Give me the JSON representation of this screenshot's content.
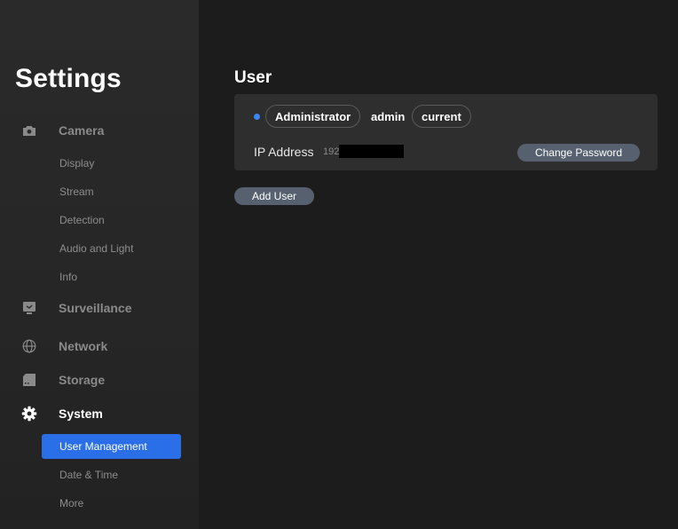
{
  "app": {
    "title": "Settings"
  },
  "sidebar": {
    "sections": [
      {
        "label": "Camera",
        "icon": "camera-icon"
      },
      {
        "label": "Surveillance",
        "icon": "monitor-icon"
      },
      {
        "label": "Network",
        "icon": "globe-icon"
      },
      {
        "label": "Storage",
        "icon": "storage-icon"
      },
      {
        "label": "System",
        "icon": "gear-icon"
      }
    ],
    "camera_items": [
      "Display",
      "Stream",
      "Detection",
      "Audio and Light",
      "Info"
    ],
    "system_items": [
      "User Management",
      "Date & Time",
      "More"
    ],
    "active_item": "User Management"
  },
  "main": {
    "title": "User",
    "user": {
      "role": "Administrator",
      "username": "admin",
      "status": "current",
      "ip_label": "IP Address",
      "ip_value": "192"
    },
    "change_password_label": "Change Password",
    "add_user_label": "Add User"
  },
  "colors": {
    "accent": "#2b6fe8",
    "status_dot": "#3a86f4",
    "button": "#56606e",
    "background": "#1c1c1c",
    "card": "#2e2e2e"
  }
}
